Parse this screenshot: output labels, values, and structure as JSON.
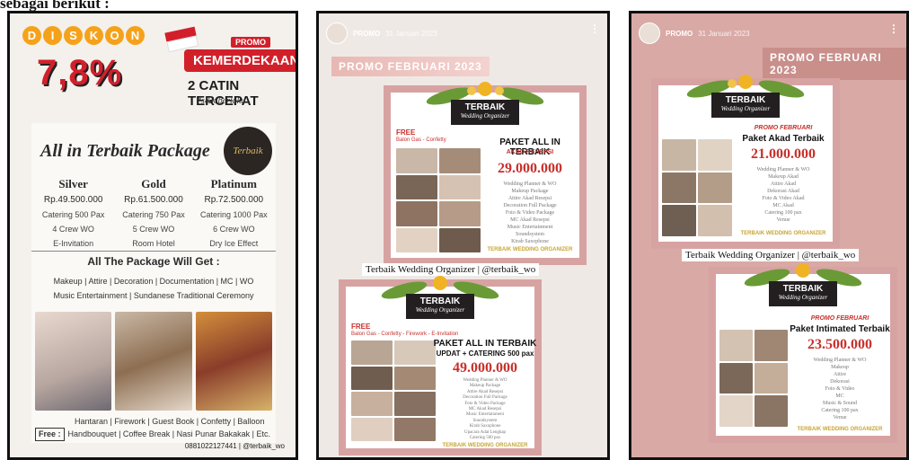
{
  "caption": "sebagai berikut :",
  "colors": {
    "red": "#d2202b",
    "flyer_border": "#d7a3a2",
    "gold": "#c8a536"
  },
  "panel1": {
    "diskon_letters": [
      "D",
      "I",
      "S",
      "K",
      "O",
      "N"
    ],
    "discount": "7,8%",
    "promo_tag": "PROMO",
    "kemerdekaan": "KEMERDEKAAN",
    "catin": "2 CATIN TERCEPAT",
    "syarat": "*s&k berlaku",
    "package_title": "All in Terbaik Package",
    "logo_text": "Terbaik",
    "tiers": [
      {
        "name": "Silver",
        "price": "Rp.49.500.000",
        "items": [
          "Catering 500 Pax",
          "4 Crew WO",
          "E-Invitation"
        ]
      },
      {
        "name": "Gold",
        "price": "Rp.61.500.000",
        "items": [
          "Catering 750 Pax",
          "5 Crew WO",
          "Room Hotel"
        ]
      },
      {
        "name": "Platinum",
        "price": "Rp.72.500.000",
        "items": [
          "Catering 1000 Pax",
          "6 Crew WO",
          "Dry Ice Effect"
        ]
      }
    ],
    "all_get": "All The Package Will Get :",
    "includes_1": "Makeup | Attire | Decoration | Documentation | MC | WO",
    "includes_2": "Music Entertainment | Sundanese Traditional Ceremony",
    "free_label": "Free :",
    "free_1": "Hantaran | Firework | Guest Book | Confetty | Balloon",
    "free_2": "Handbouquet | Coffee Break | Nasi Punar Bakakak | Etc.",
    "contact": "0881022127441 | @terbaik_wo"
  },
  "panel2": {
    "handle": "PROMO",
    "date": "31 Januari 2023",
    "banner": "PROMO FEBRUARI 2023",
    "flyer1": {
      "logo1": "TERBAIK",
      "logo2": "Wedding Organizer",
      "free": "FREE",
      "free_line": "Balon Gas - Confetty",
      "title": "PAKET ALL IN TERBAIK",
      "subtitle": "AKAD RESEPSI",
      "price": "29.000.000",
      "list": [
        "Wedding Planner & WO",
        "Makeup Package",
        "Attire Akad Resepsi",
        "Decoration Full Package",
        "Foto & Video Package",
        "MC Akad Resepsi",
        "Music Entertainment",
        "Soundsystem",
        "Kirab Saxophone"
      ],
      "footer": "TERBAIK WEDDING ORGANIZER"
    },
    "credit": "Terbaik Wedding Organizer | @terbaik_wo",
    "flyer2": {
      "logo1": "TERBAIK",
      "logo2": "Wedding Organizer",
      "free": "FREE",
      "free_line": "Balon Gas - Confetty - Firework - E-Invitation",
      "title": "PAKET ALL IN TERBAIK",
      "subtitle": "UPDAT + CATERING 500 pax",
      "price": "49.000.000",
      "list": [
        "Wedding Planner & WO",
        "Makeup Package",
        "Attire Akad Resepsi",
        "Decoration Full Package",
        "Foto & Video Package",
        "MC Akad Resepsi",
        "Music Entertainment",
        "Soundsystem",
        "Kirab Saxophone",
        "Upacara Adat Lengkap",
        "Catering 500 pax"
      ],
      "footer": "TERBAIK WEDDING ORGANIZER"
    }
  },
  "panel3": {
    "handle": "PROMO",
    "date": "31 Januari 2023",
    "banner": "PROMO FEBRUARI 2023",
    "flyer1": {
      "logo1": "TERBAIK",
      "logo2": "Wedding Organizer",
      "small": "PROMO FEBRUARI",
      "title": "Paket Akad Terbaik",
      "price": "21.000.000",
      "list": [
        "Wedding Planner & WO",
        "Makeup Akad",
        "Attire Akad",
        "Dekorasi Akad",
        "Foto & Video Akad",
        "MC Akad",
        "Catering 100 pax",
        "Venue"
      ],
      "footer": "TERBAIK WEDDING ORGANIZER"
    },
    "credit": "Terbaik Wedding Organizer | @terbaik_wo",
    "flyer2": {
      "logo1": "TERBAIK",
      "logo2": "Wedding Organizer",
      "small": "PROMO FEBRUARI",
      "title": "Paket Intimated Terbaik",
      "price": "23.500.000",
      "list": [
        "Wedding Planner & WO",
        "Makeup",
        "Attire",
        "Dekorasi",
        "Foto & Video",
        "MC",
        "Music & Sound",
        "Catering 100 pax",
        "Venue"
      ],
      "footer": "TERBAIK WEDDING ORGANIZER"
    }
  }
}
